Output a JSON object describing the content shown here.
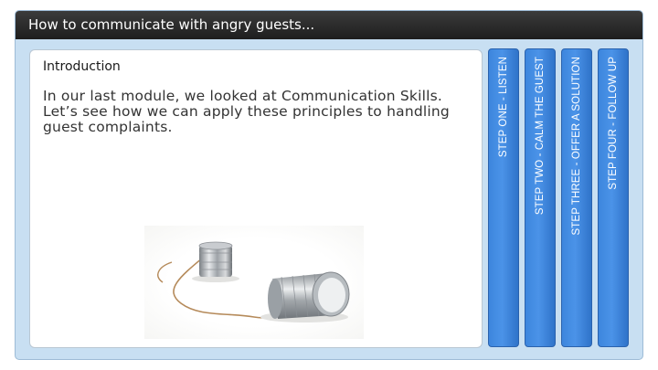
{
  "window": {
    "title": "How to communicate with angry guests..."
  },
  "content": {
    "heading": "Introduction",
    "body": "In our last module, we looked at Communication Skills. Let’s see how we can apply these principles to handling guest complaints.",
    "image": "tin-can-telephone"
  },
  "steps": [
    {
      "label": "STEP ONE - LISTEN"
    },
    {
      "label": "STEP TWO - CALM THE GUEST"
    },
    {
      "label": "STEP THREE - OFFER A SOLUTION"
    },
    {
      "label": "STEP FOUR - FOLLOW UP"
    }
  ],
  "colors": {
    "titlebar": "#2a2a2a",
    "tab": "#4a90e2",
    "frame": "#c8dff2"
  }
}
